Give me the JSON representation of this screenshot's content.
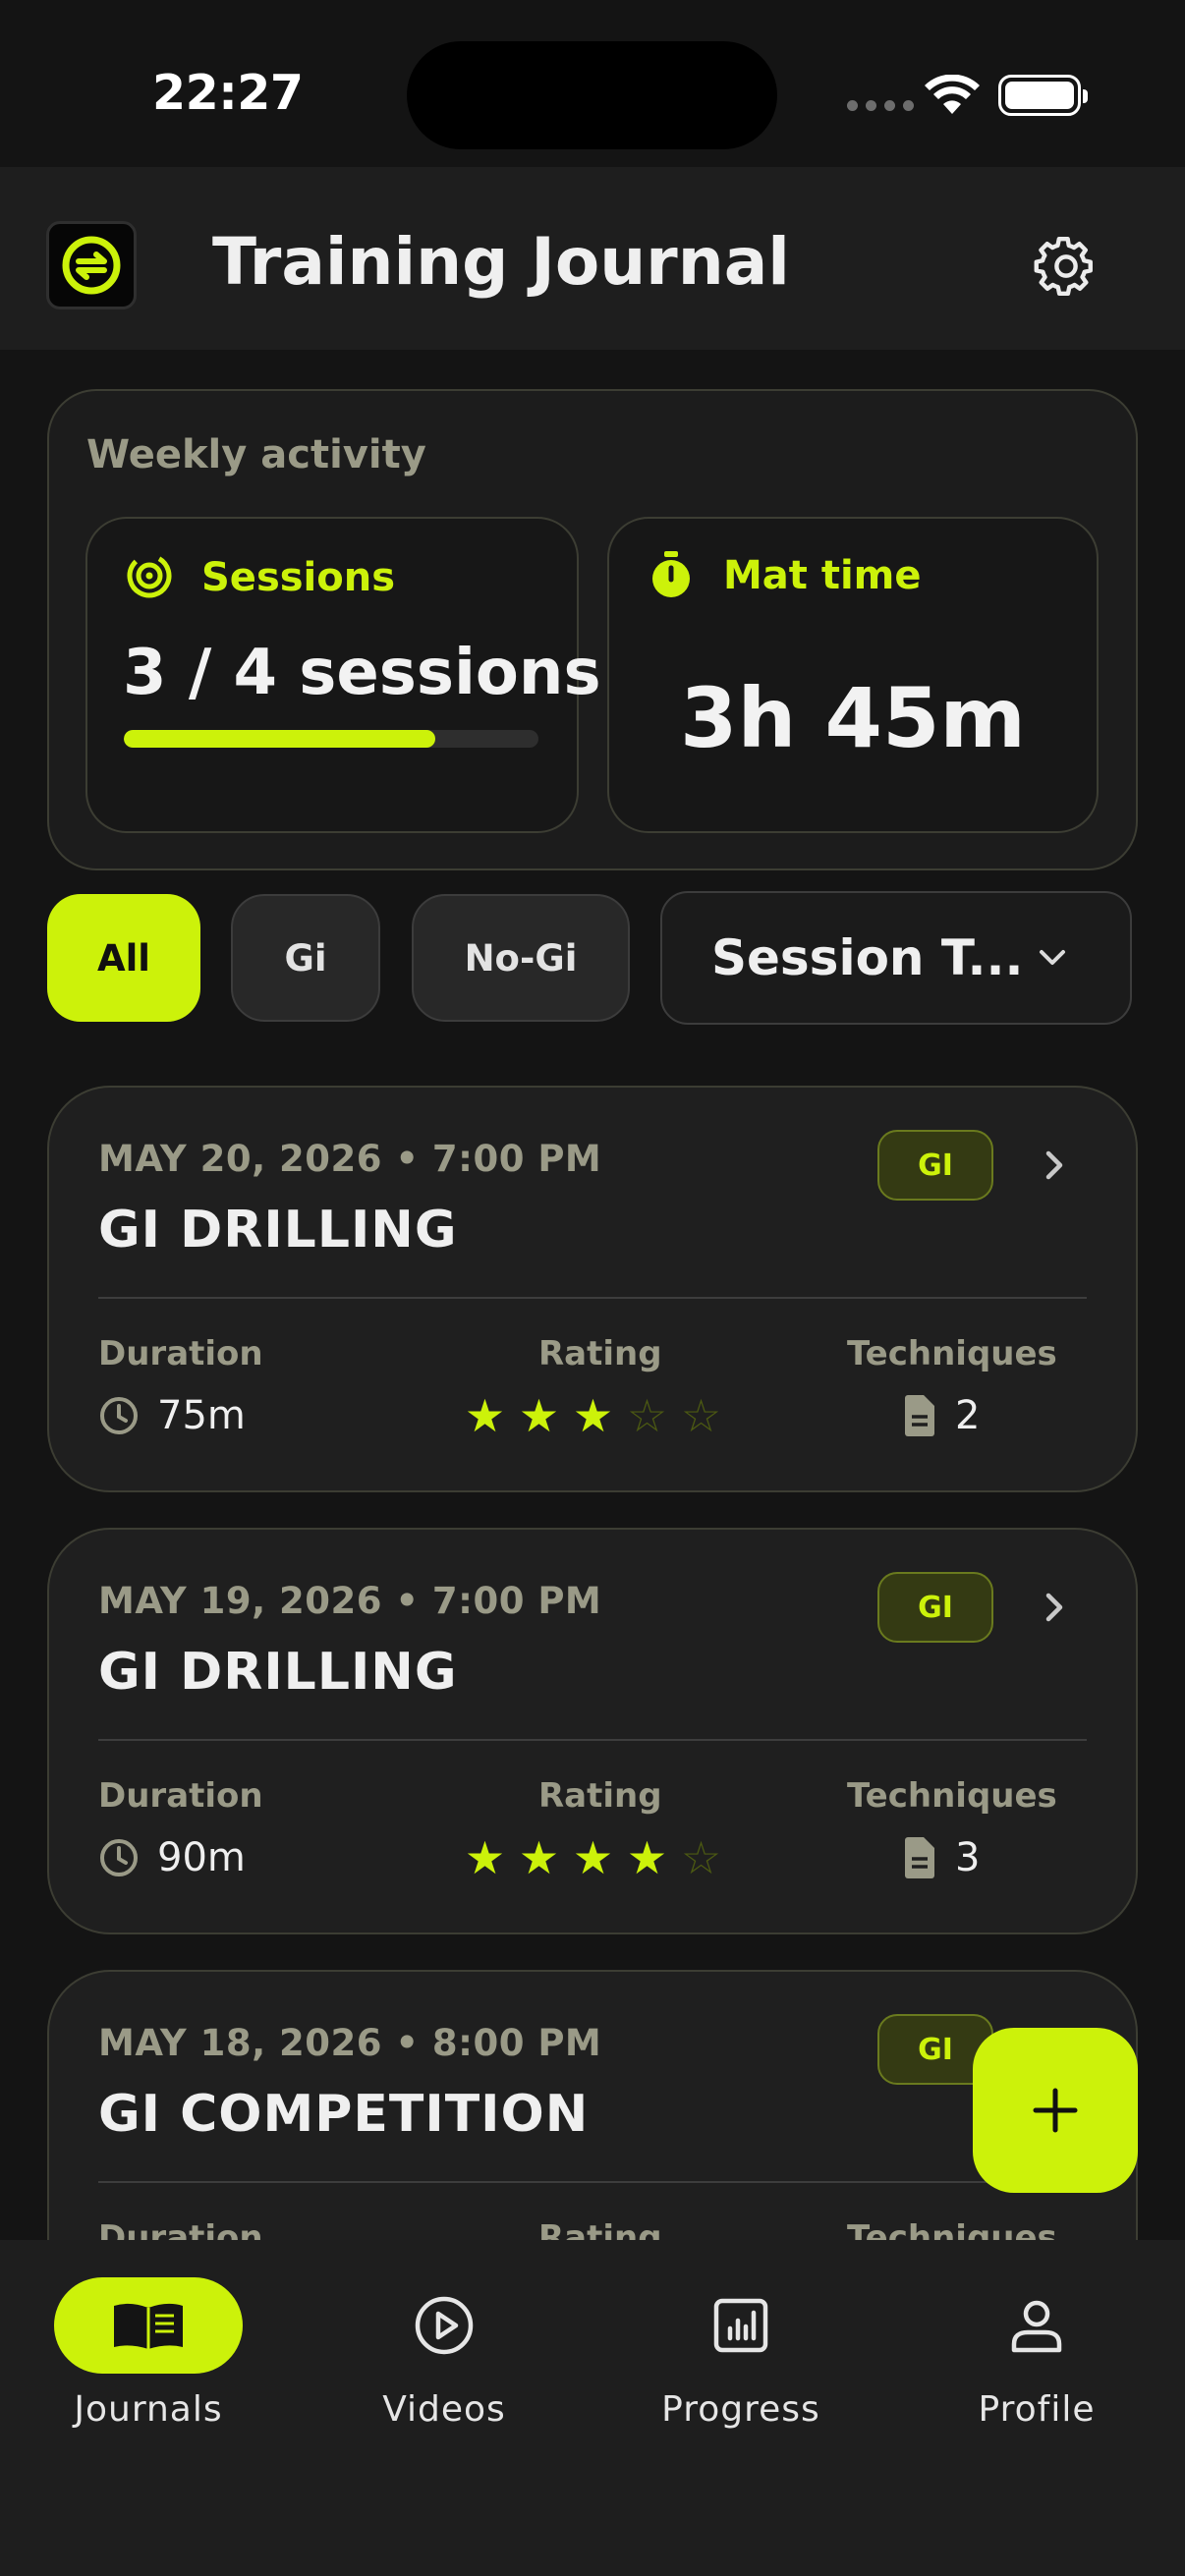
{
  "status_bar": {
    "time": "22:27"
  },
  "header": {
    "title": "Training Journal"
  },
  "weekly": {
    "title": "Weekly activity",
    "sessions_label": "Sessions",
    "sessions_value": "3 / 4 sessions",
    "sessions_progress": 0.75,
    "mat_label": "Mat time",
    "mat_value": "3h 45m"
  },
  "filters": {
    "chips": [
      "All",
      "Gi",
      "No-Gi"
    ],
    "selected": "All",
    "session_type": "Session T..."
  },
  "sessions": [
    {
      "date": "MAY 20, 2026 • 7:00 PM",
      "title": "GI DRILLING",
      "badge": "GI",
      "duration_label": "Duration",
      "duration": "75m",
      "rating_label": "Rating",
      "rating": 3,
      "techniques_label": "Techniques",
      "techniques": "2"
    },
    {
      "date": "MAY 19, 2026 • 7:00 PM",
      "title": "GI DRILLING",
      "badge": "GI",
      "duration_label": "Duration",
      "duration": "90m",
      "rating_label": "Rating",
      "rating": 4,
      "techniques_label": "Techniques",
      "techniques": "3"
    },
    {
      "date": "MAY 18, 2026 • 8:00 PM",
      "title": "GI COMPETITION",
      "badge": "GI",
      "duration_label": "Duration",
      "rating_label": "Rating",
      "techniques_label": "Techniques"
    }
  ],
  "nav": [
    {
      "label": "Journals",
      "icon": "book-open-icon",
      "active": true
    },
    {
      "label": "Videos",
      "icon": "play-circle-icon",
      "active": false
    },
    {
      "label": "Progress",
      "icon": "bar-chart-icon",
      "active": false
    },
    {
      "label": "Profile",
      "icon": "user-icon",
      "active": false
    }
  ],
  "colors": {
    "accent": "#ccf20a",
    "background": "#141414",
    "card": "#1f1f1f",
    "muted": "#9a9a87"
  }
}
